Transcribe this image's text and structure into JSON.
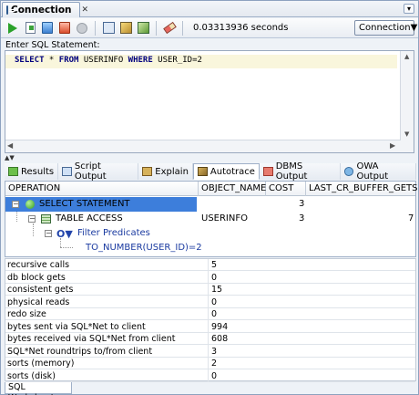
{
  "window": {
    "title": "Connection",
    "close_glyph": "✕",
    "menu_glyph": "▾"
  },
  "toolbar": {
    "icons": [
      "run-statement-icon",
      "run-script-icon",
      "commit-icon",
      "rollback-icon",
      "cancel-icon",
      "history-icon",
      "explain-icon",
      "autotrace-icon",
      "clear-icon"
    ],
    "timing": "0.03313936 seconds",
    "connection_label": "Connection",
    "connection_arrow": "▼"
  },
  "editor": {
    "label": "Enter SQL Statement:",
    "sql": {
      "kw1": "SELECT",
      "star": " * ",
      "kw2": "FROM",
      "table": " USERINFO ",
      "kw3": "WHERE",
      "cond": " USER_ID=2"
    }
  },
  "results_tabs": [
    {
      "label": "Results",
      "icon": "results-icon"
    },
    {
      "label": "Script Output",
      "icon": "script-output-icon"
    },
    {
      "label": "Explain",
      "icon": "explain-icon"
    },
    {
      "label": "Autotrace",
      "icon": "autotrace-icon"
    },
    {
      "label": "DBMS Output",
      "icon": "dbms-output-icon"
    },
    {
      "label": "OWA Output",
      "icon": "owa-output-icon"
    }
  ],
  "plan": {
    "columns": [
      "OPERATION",
      "OBJECT_NAME",
      "COST",
      "LAST_CR_BUFFER_GETS"
    ],
    "rows": [
      {
        "operation": "SELECT STATEMENT",
        "object_name": "",
        "cost": "3",
        "gets": ""
      },
      {
        "operation": "TABLE ACCESS",
        "object_name": "USERINFO",
        "cost": "3",
        "gets": "7"
      },
      {
        "operation": "Filter Predicates",
        "object_name": "",
        "cost": "",
        "gets": ""
      },
      {
        "operation": "TO_NUMBER(USER_ID)=2",
        "object_name": "",
        "cost": "",
        "gets": ""
      }
    ]
  },
  "stats": [
    {
      "name": "recursive calls",
      "value": "5"
    },
    {
      "name": "db block gets",
      "value": "0"
    },
    {
      "name": "consistent gets",
      "value": "15"
    },
    {
      "name": "physical reads",
      "value": "0"
    },
    {
      "name": "redo size",
      "value": "0"
    },
    {
      "name": "bytes sent via SQL*Net to client",
      "value": "994"
    },
    {
      "name": "bytes received via SQL*Net from client",
      "value": "608"
    },
    {
      "name": "SQL*Net roundtrips to/from client",
      "value": "3"
    },
    {
      "name": "sorts (memory)",
      "value": "2"
    },
    {
      "name": "sorts (disk)",
      "value": "0"
    }
  ],
  "bottom_tab": "SQL Worksheet"
}
